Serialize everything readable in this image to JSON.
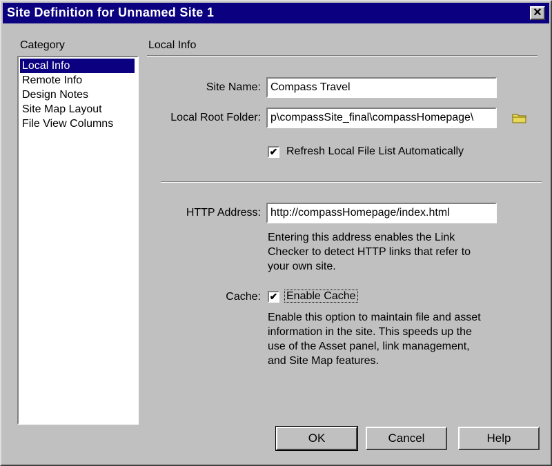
{
  "window": {
    "title": "Site Definition for Unnamed Site 1",
    "close_label": "✕"
  },
  "category": {
    "label": "Category",
    "items": [
      {
        "label": "Local Info",
        "selected": true
      },
      {
        "label": "Remote Info",
        "selected": false
      },
      {
        "label": "Design Notes",
        "selected": false
      },
      {
        "label": "Site Map Layout",
        "selected": false
      },
      {
        "label": "File View Columns",
        "selected": false
      }
    ]
  },
  "local_info": {
    "section_title": "Local Info",
    "site_name": {
      "label": "Site Name:",
      "value": "Compass Travel"
    },
    "local_root": {
      "label": "Local Root Folder:",
      "value": "p\\compassSite_final\\compassHomepage\\"
    },
    "refresh": {
      "label": "Refresh Local File List Automatically",
      "checked": true,
      "check_mark": "✔"
    },
    "http": {
      "label": "HTTP Address:",
      "value": "http://compassHomepage/index.html",
      "help": [
        "Entering this address enables the Link",
        "Checker to detect HTTP links that refer to",
        "your own site."
      ]
    },
    "cache": {
      "label": "Cache:",
      "checkbox_label": "Enable Cache",
      "checked": true,
      "check_mark": "✔",
      "help": [
        "Enable this option to maintain file and asset",
        "information in the site.  This speeds up the",
        "use of the Asset panel, link management,",
        "and Site Map features."
      ]
    }
  },
  "buttons": {
    "ok": "OK",
    "cancel": "Cancel",
    "help": "Help"
  }
}
